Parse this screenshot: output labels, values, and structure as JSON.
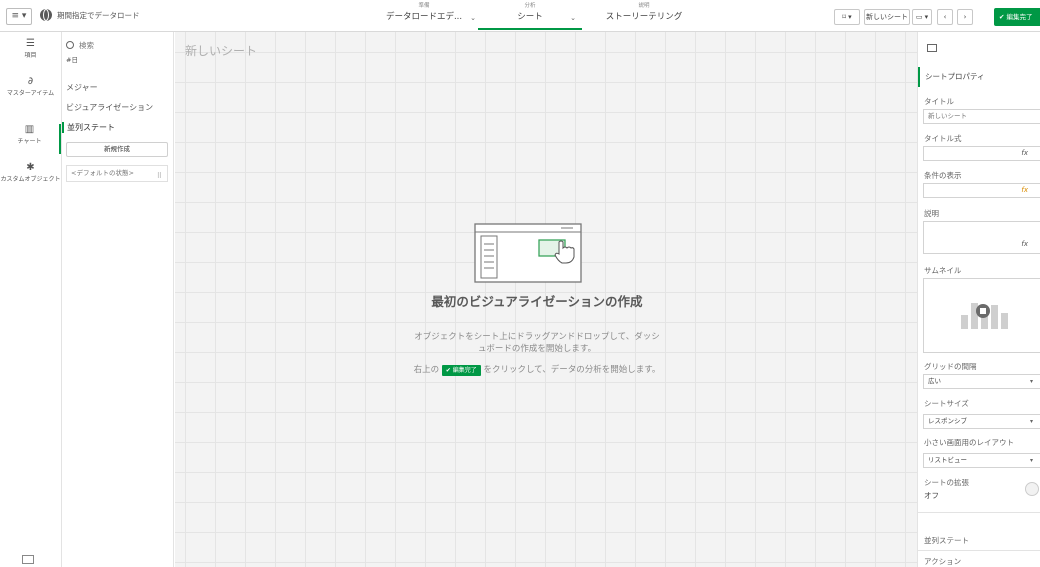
{
  "topbar": {
    "menu_label": "≡ ▾",
    "app_name": "期間指定でデータロード",
    "nav": [
      {
        "small": "準備",
        "label": "データロードエデ..."
      },
      {
        "small": "分析",
        "label": "シート"
      },
      {
        "small": "説明",
        "label": "ストーリーテリング"
      }
    ],
    "bookmark_btn": "⌑ ▾",
    "sheet_name_btn": "新しいシート",
    "done_btn": "✔ 編集完了"
  },
  "leftrail": {
    "items": [
      {
        "icon": "database-icon",
        "label": "項目"
      },
      {
        "icon": "master-items-icon",
        "label": "マスターアイテム"
      },
      {
        "icon": "chart-icon",
        "label": "チャート"
      },
      {
        "icon": "puzzle-icon",
        "label": "カスタムオブジェクト"
      }
    ]
  },
  "assets": {
    "search_placeholder": "検索",
    "field": "#日",
    "items": [
      "メジャー",
      "ビジュアライゼーション",
      "並列ステート"
    ],
    "new_button": "新規作成",
    "default_state": "<デフォルトの状態>"
  },
  "canvas": {
    "sheet_title": "新しいシート",
    "empty_title": "最初のビジュアライゼーションの作成",
    "empty_desc": "オブジェクトをシート上にドラッグアンドドロップして、ダッシュボードの作成を開始します。",
    "hint_before": "右上の",
    "hint_button": "✔ 編集完了",
    "hint_after": "をクリックして、データの分析を開始します。"
  },
  "props": {
    "header": "シートプロパティ",
    "title_label": "タイトル",
    "title_value": "新しいシート",
    "title_expr_label": "タイトル式",
    "condition_label": "条件の表示",
    "description_label": "説明",
    "thumbnail_label": "サムネイル",
    "grid_spacing_label": "グリッドの間隔",
    "grid_spacing_value": "広い",
    "sheet_size_label": "シートサイズ",
    "sheet_size_value": "レスポンシブ",
    "small_layout_label": "小さい画面用のレイアウト",
    "small_layout_value": "リストビュー",
    "extend_label": "シートの拡張",
    "extend_value": "オフ",
    "alt_state": "並列ステート",
    "actions": "アクション",
    "fx": "fx"
  },
  "colors": {
    "accent": "#009845",
    "canvas_bg": "#f3f3f3"
  }
}
